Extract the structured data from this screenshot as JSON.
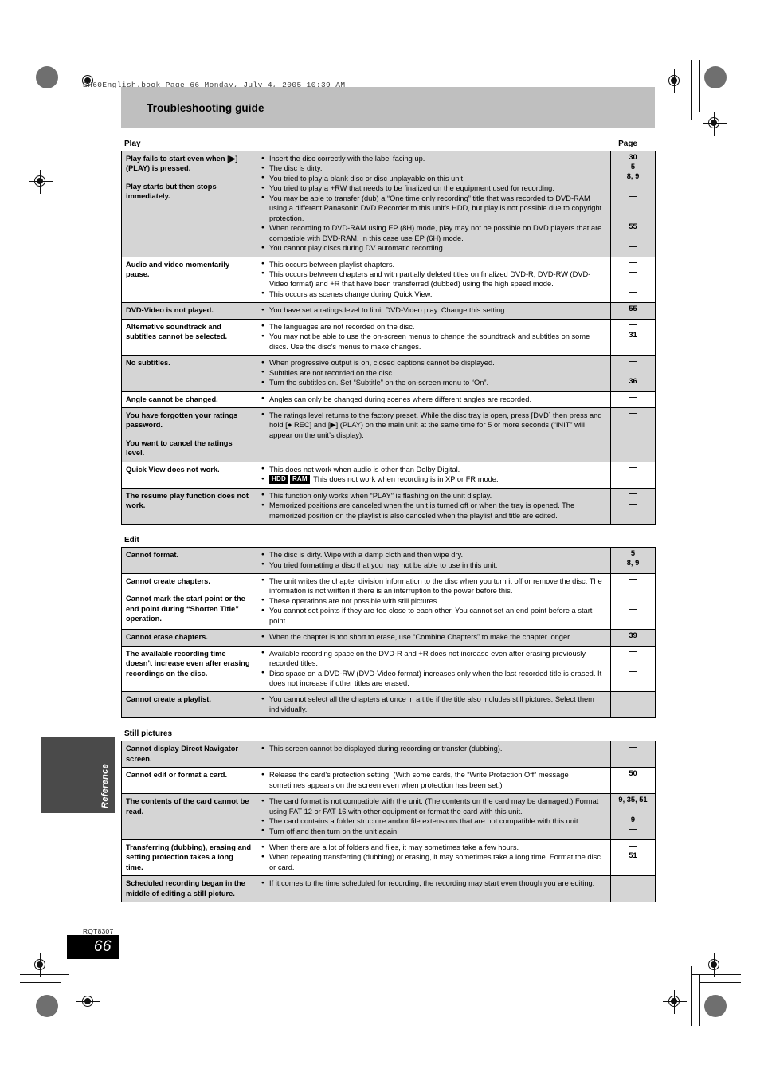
{
  "document": {
    "file_header": "EH60English.book  Page 66  Monday, July 4, 2005  10:39 AM",
    "title": "Troubleshooting guide",
    "side_tab": "Reference",
    "footer_code": "RQT8307",
    "page_number": "66",
    "page_column_label": "Page"
  },
  "sections": [
    {
      "heading": "Play",
      "rows": [
        {
          "symptom": [
            "Play fails to start even when [▶] (PLAY) is pressed.",
            "Play starts but then stops immediately."
          ],
          "causes": [
            {
              "text": "Insert the disc correctly with the label facing up.",
              "page": "30"
            },
            {
              "text": "The disc is dirty.",
              "page": "5"
            },
            {
              "text": "You tried to play a blank disc or disc unplayable on this unit.",
              "page": "8, 9"
            },
            {
              "text": "You tried to play a +RW that needs to be finalized on the equipment used for recording.",
              "page": "—"
            },
            {
              "text": "You may be able to transfer (dub) a “One time only recording” title that was recorded to DVD-RAM using a different Panasonic DVD Recorder to this unit’s HDD, but play is not possible due to copyright protection.",
              "page": "—"
            },
            {
              "text": "When recording to DVD-RAM using EP (8H) mode, play may not be possible on DVD players that are compatible with DVD-RAM. In this case use EP (6H) mode.",
              "page": "55"
            },
            {
              "text": "You cannot play discs during DV automatic recording.",
              "page": "—"
            }
          ]
        },
        {
          "symptom": [
            "Audio and video momentarily pause."
          ],
          "causes": [
            {
              "text": "This occurs between playlist chapters.",
              "page": "—"
            },
            {
              "text": "This occurs between chapters and with partially deleted titles on finalized DVD-R, DVD-RW (DVD-Video format) and +R that have been transferred (dubbed) using the high speed mode.",
              "page": "—"
            },
            {
              "text": "This occurs as scenes change during Quick View.",
              "page": "—"
            }
          ]
        },
        {
          "symptom": [
            "DVD-Video is not played."
          ],
          "causes": [
            {
              "text": "You have set a ratings level to limit DVD-Video play. Change this setting.",
              "page": "55"
            }
          ]
        },
        {
          "symptom": [
            "Alternative soundtrack and subtitles cannot be selected."
          ],
          "causes": [
            {
              "text": "The languages are not recorded on the disc.",
              "page": "—"
            },
            {
              "text": "You may not be able to use the on-screen menus to change the soundtrack and subtitles on some discs. Use the disc’s menus to make changes.",
              "page": "31"
            }
          ]
        },
        {
          "symptom": [
            "No subtitles."
          ],
          "causes": [
            {
              "text": "When progressive output is on, closed captions cannot be displayed.",
              "page": "—"
            },
            {
              "text": "Subtitles are not recorded on the disc.",
              "page": "—"
            },
            {
              "text": "Turn the subtitles on. Set “Subtitle” on the on-screen menu to “On”.",
              "page": "36"
            }
          ]
        },
        {
          "symptom": [
            "Angle cannot be changed."
          ],
          "causes": [
            {
              "text": "Angles can only be changed during scenes where different angles are recorded.",
              "page": "—"
            }
          ]
        },
        {
          "symptom": [
            "You have forgotten your ratings password.",
            "You want to cancel the ratings level."
          ],
          "causes": [
            {
              "text": "The ratings level returns to the factory preset. While the disc tray is open, press [DVD] then press and hold [● REC] and [▶] (PLAY) on the main unit at the same time for 5 or more seconds (“INIT” will appear on the unit’s display).",
              "page": "—"
            }
          ]
        },
        {
          "symptom": [
            "Quick View does not work."
          ],
          "causes": [
            {
              "text": "This does not work when audio is other than Dolby Digital.",
              "page": "—"
            },
            {
              "badges": [
                "HDD",
                "RAM"
              ],
              "text": "This does not work when recording is in XP or FR mode.",
              "page": "—"
            }
          ]
        },
        {
          "symptom": [
            "The resume play function does not work."
          ],
          "causes": [
            {
              "text": "This function only works when “PLAY” is flashing on the unit display.",
              "page": "—"
            },
            {
              "text": "Memorized positions are canceled when the unit is turned off or when the tray is opened. The memorized position on the playlist is also canceled when the playlist and title are edited.",
              "page": "—"
            }
          ]
        }
      ]
    },
    {
      "heading": "Edit",
      "rows": [
        {
          "symptom": [
            "Cannot format."
          ],
          "causes": [
            {
              "text": "The disc is dirty. Wipe with a damp cloth and then wipe dry.",
              "page": "5"
            },
            {
              "text": "You tried formatting a disc that you may not be able to use in this unit.",
              "page": "8, 9"
            }
          ]
        },
        {
          "symptom": [
            "Cannot create chapters.",
            "Cannot mark the start point or the end point during “Shorten Title” operation."
          ],
          "causes": [
            {
              "text": "The unit writes the chapter division information to the disc when you turn it off or remove the disc. The information is not written if there is an interruption to the power before this.",
              "page": "—"
            },
            {
              "text": "These operations are not possible with still pictures.",
              "page": "—"
            },
            {
              "text": "You cannot set points if they are too close to each other. You cannot set an end point before a start point.",
              "page": "—"
            }
          ]
        },
        {
          "symptom": [
            "Cannot erase chapters."
          ],
          "causes": [
            {
              "text": "When the chapter is too short to erase, use “Combine Chapters” to make the chapter longer.",
              "page": "39"
            }
          ]
        },
        {
          "symptom": [
            "The available recording time doesn’t increase even after erasing recordings on the disc."
          ],
          "causes": [
            {
              "text": "Available recording space on the DVD-R and +R does not increase even after erasing previously recorded titles.",
              "page": "—"
            },
            {
              "text": "Disc space on a DVD-RW (DVD-Video format) increases only when the last recorded title is erased. It does not increase if other titles are erased.",
              "page": "—"
            }
          ]
        },
        {
          "symptom": [
            "Cannot create a playlist."
          ],
          "causes": [
            {
              "text": "You cannot select all the chapters at once in a title if the title also includes still pictures. Select them individually.",
              "page": "—"
            }
          ]
        }
      ]
    },
    {
      "heading": "Still pictures",
      "rows": [
        {
          "symptom": [
            "Cannot display Direct Navigator screen."
          ],
          "causes": [
            {
              "text": "This screen cannot be displayed during recording or transfer (dubbing).",
              "page": "—"
            }
          ]
        },
        {
          "symptom": [
            "Cannot edit or format a card."
          ],
          "causes": [
            {
              "text": "Release the card’s protection setting. (With some cards, the “Write Protection Off” message sometimes appears on the screen even when protection has been set.)",
              "page": "50"
            }
          ]
        },
        {
          "symptom": [
            "The contents of the card cannot be read."
          ],
          "causes": [
            {
              "text": "The card format is not compatible with the unit. (The contents on the card may be damaged.) Format using FAT 12 or FAT 16 with other equipment or format the card with this unit.",
              "page": "9, 35, 51"
            },
            {
              "text": "The card contains a folder structure and/or file extensions that are not compatible with this unit.",
              "page": "9"
            },
            {
              "text": "Turn off and then turn on the unit again.",
              "page": "—"
            }
          ]
        },
        {
          "symptom": [
            "Transferring (dubbing), erasing and setting protection takes a long time."
          ],
          "causes": [
            {
              "text": "When there are a lot of folders and files, it may sometimes take a few hours.",
              "page": "—"
            },
            {
              "text": "When repeating transferring (dubbing) or erasing, it may sometimes take a long time. Format the disc or card.",
              "page": "51"
            }
          ]
        },
        {
          "symptom": [
            "Scheduled recording began in the middle of editing a still picture."
          ],
          "causes": [
            {
              "text": "If it comes to the time scheduled for recording, the recording may start even though you are editing.",
              "page": "—"
            }
          ]
        }
      ]
    }
  ],
  "colors": {
    "band": "#bfbfbf",
    "row_shade": "#d5d5d5",
    "side_tab": "#4a4a4a",
    "page_box": "#000000"
  }
}
